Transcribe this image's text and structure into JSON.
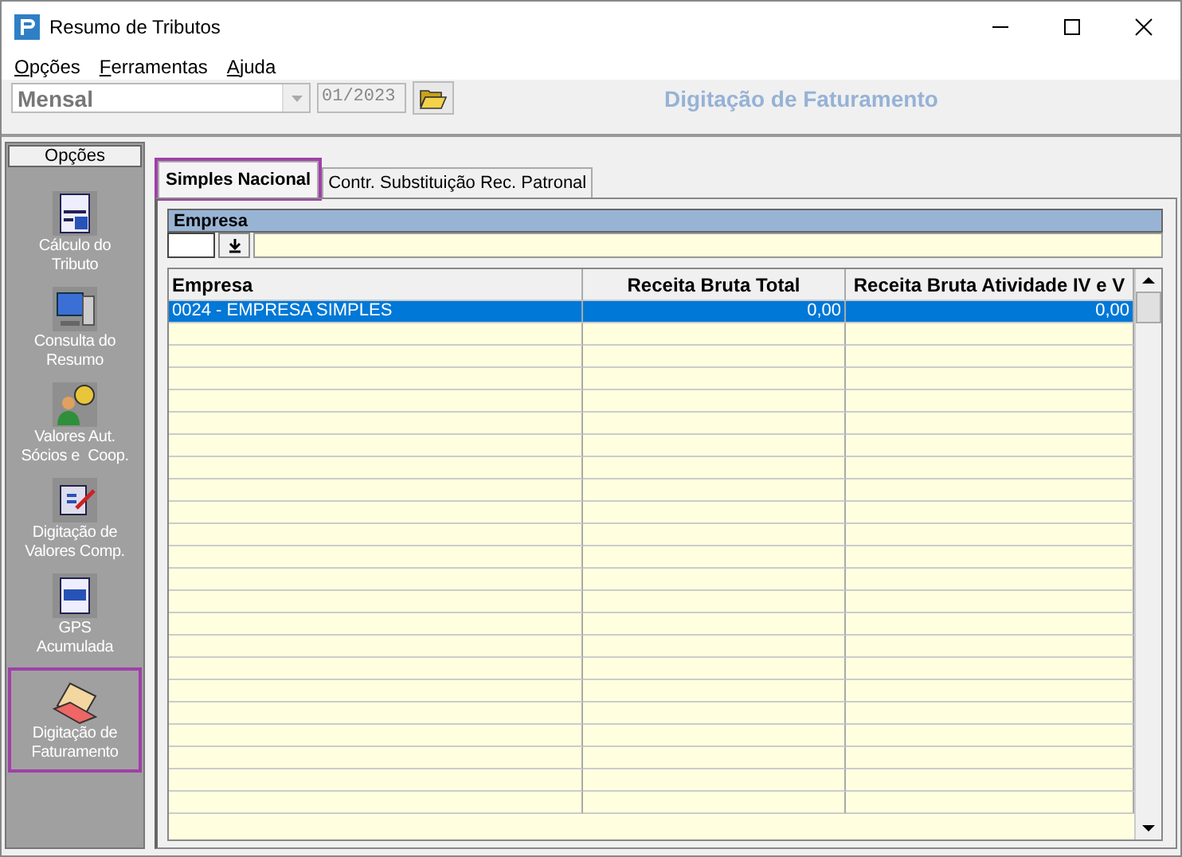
{
  "window": {
    "title": "Resumo de Tributos"
  },
  "menu": [
    {
      "label": "Opções"
    },
    {
      "label": "Ferramentas"
    },
    {
      "label": "Ajuda"
    }
  ],
  "toolbar": {
    "period_type": "Mensal",
    "period": "01/2023",
    "screen_title": "Digitação de Faturamento"
  },
  "sidebar": {
    "header": "Opções",
    "items": [
      {
        "label": "Cálculo do\nTributo",
        "kind": "calc",
        "selected": false
      },
      {
        "label": "Consulta do\nResumo",
        "kind": "computer",
        "selected": false
      },
      {
        "label": "Valores Aut.\nSócios e  Coop.",
        "kind": "people",
        "selected": false
      },
      {
        "label": "Digitação de\nValores Comp.",
        "kind": "edit",
        "selected": false
      },
      {
        "label": "GPS\nAcumulada",
        "kind": "gps",
        "selected": false
      },
      {
        "label": "Digitação de\nFaturamento",
        "kind": "laptop",
        "selected": true
      }
    ]
  },
  "tabs": [
    {
      "label": "Simples Nacional",
      "selected": true
    },
    {
      "label": "Contr. Substituição Rec. Patronal",
      "selected": false
    }
  ],
  "filter": {
    "label": "Empresa"
  },
  "table": {
    "columns": [
      "Empresa",
      "Receita Bruta Total",
      "Receita Bruta Atividade IV e V"
    ],
    "rows": [
      {
        "cells": [
          "0024 - EMPRESA SIMPLES",
          "0,00",
          "0,00"
        ],
        "selected": true
      }
    ]
  }
}
